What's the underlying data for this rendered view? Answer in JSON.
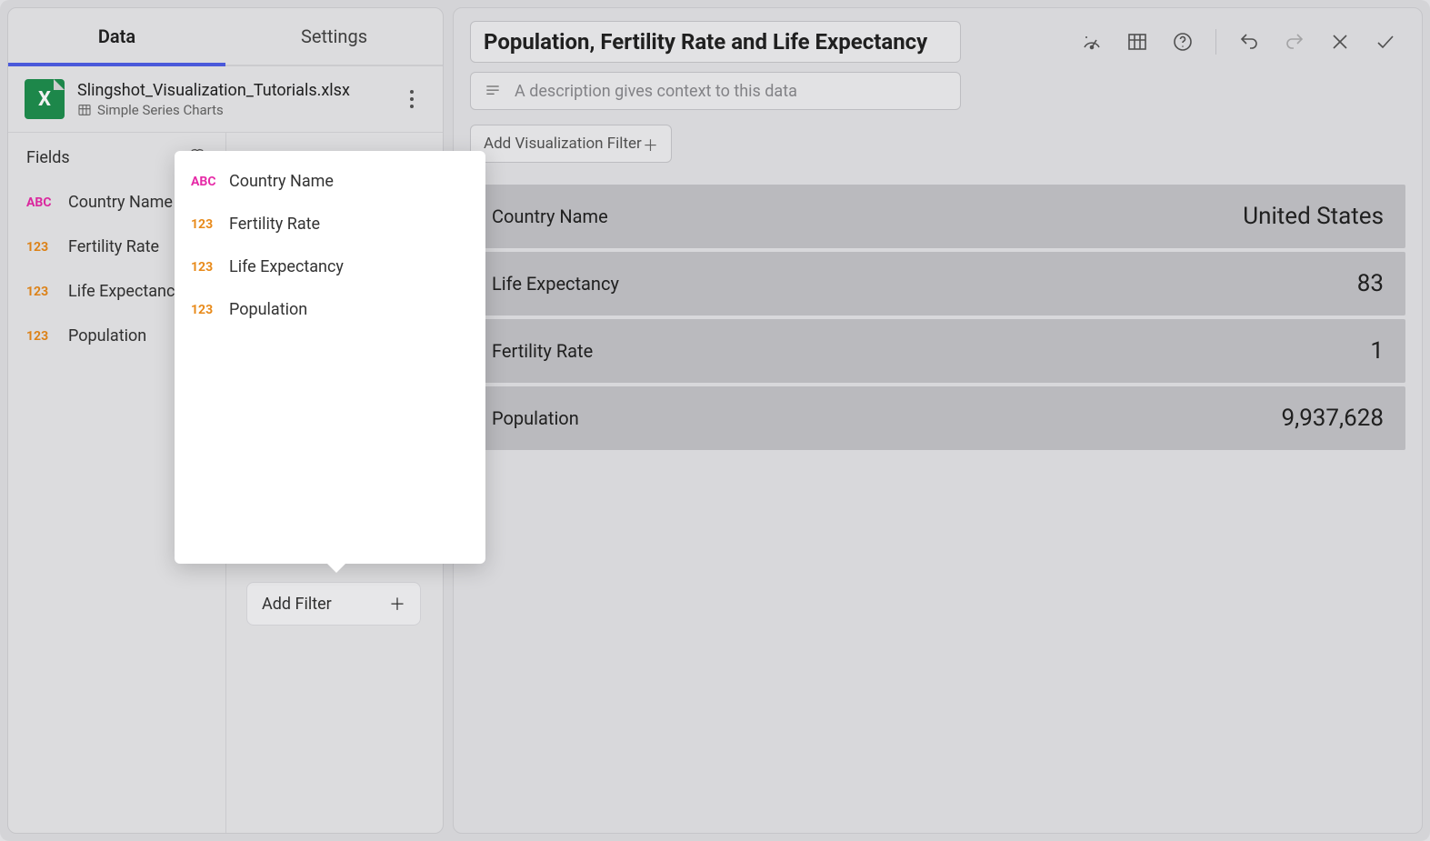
{
  "sidebar": {
    "tabs": {
      "data": "Data",
      "settings": "Settings"
    },
    "source": {
      "title": "Slingshot_Visualization_Tutorials.xlsx",
      "subtitle": "Simple Series Charts"
    },
    "fields_header": "Fields",
    "fields": [
      {
        "type": "ABC",
        "name": "Country Name"
      },
      {
        "type": "123",
        "name": "Fertility Rate"
      },
      {
        "type": "123",
        "name": "Life Expectancy"
      },
      {
        "type": "123",
        "name": "Population"
      }
    ],
    "add_filter_label": "Add Filter"
  },
  "popover": {
    "items": [
      {
        "type": "ABC",
        "name": "Country Name"
      },
      {
        "type": "123",
        "name": "Fertility Rate"
      },
      {
        "type": "123",
        "name": "Life Expectancy"
      },
      {
        "type": "123",
        "name": "Population"
      }
    ]
  },
  "main": {
    "title": "Population, Fertility Rate and Life Expectancy",
    "description_placeholder": "A description gives context to this data",
    "add_viz_filter_label": "Add Visualization Filter",
    "rows": [
      {
        "label": "Country Name",
        "value": "United States"
      },
      {
        "label": "Life Expectancy",
        "value": "83"
      },
      {
        "label": "Fertility Rate",
        "value": "1"
      },
      {
        "label": "Population",
        "value": "9,937,628"
      }
    ]
  }
}
